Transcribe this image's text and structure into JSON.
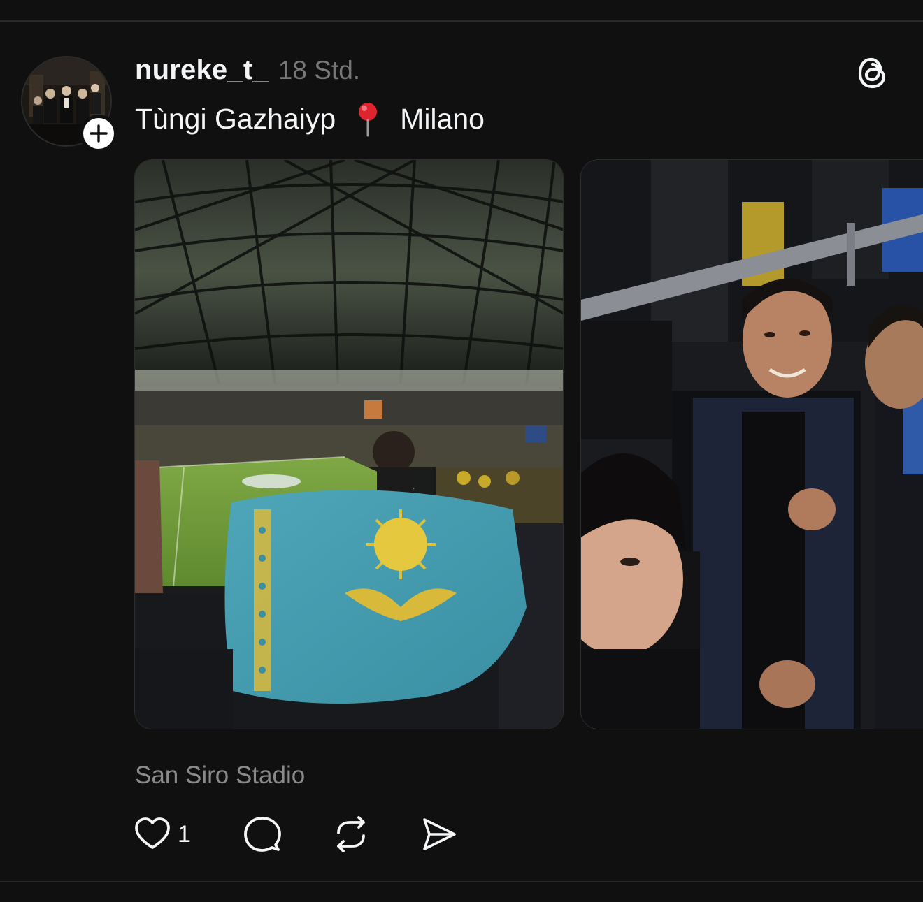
{
  "post": {
    "username": "nureke_t_",
    "timestamp": "18 Std.",
    "caption_before": "Tùngi Gazhaiyp",
    "caption_emoji": "pin-icon",
    "caption_after": "Milano",
    "location_tag": "San Siro Stadio",
    "likes_count": "1",
    "app_icon": "threads-logo-icon",
    "media": [
      {
        "description": "stadium-flag-photo"
      },
      {
        "description": "group-selfie-photo"
      }
    ]
  },
  "colors": {
    "background": "#101010",
    "text": "#f3f5f7",
    "secondary_text": "#777777",
    "location_text": "#8a8a8a",
    "divider": "#2a2a2a",
    "pin_red": "#e0242f"
  },
  "actions": [
    {
      "icon": "heart-icon"
    },
    {
      "icon": "comment-icon"
    },
    {
      "icon": "repost-icon"
    },
    {
      "icon": "share-icon"
    }
  ]
}
